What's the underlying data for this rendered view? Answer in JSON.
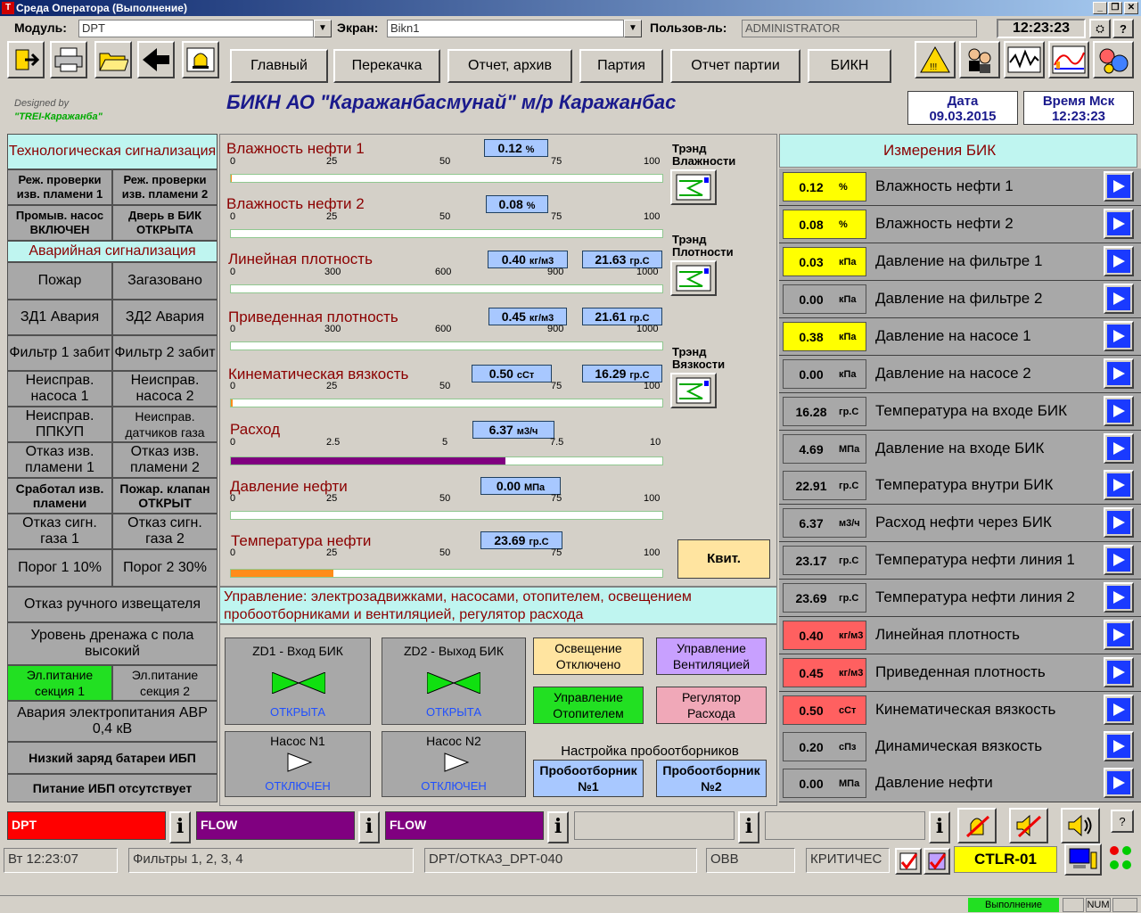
{
  "window": {
    "title": "Среда Оператора (Выполнение)",
    "app_icon": "T"
  },
  "toolbar": {
    "module_label": "Модуль:",
    "module_value": "DPT",
    "screen_label": "Экран:",
    "screen_value": "Bikn1",
    "user_label": "Пользов-ль:",
    "user_value": "ADMINISTRATOR",
    "clock": "12:23:23"
  },
  "nav": {
    "main": "Главный",
    "pump": "Перекачка",
    "report": "Отчет, архив",
    "batch": "Партия",
    "batch_report": "Отчет партии",
    "bikn": "БИКН"
  },
  "header": {
    "designed_by": "Designed by",
    "company": "\"TREI-Каражанба\"",
    "title": "БИКН АО \"Каражанбасмунай\" м/р Каражанбас",
    "date_label": "Дата",
    "date_value": "09.03.2015",
    "time_label": "Время Мск",
    "time_value": "12:23:23"
  },
  "left": {
    "tech_alarm": "Технологическая сигнализация",
    "flame_check1": "Реж. проверки изв. пламени 1",
    "flame_check2": "Реж. проверки изв. пламени 2",
    "flush_pump": "Промыв. насос ВКЛЮЧЕН",
    "door": "Дверь в БИК ОТКРЫТА",
    "emergency": "Аварийная сигнализация",
    "fire": "Пожар",
    "gas": "Загазовано",
    "zd1": "ЗД1 Авария",
    "zd2": "ЗД2 Авария",
    "filter1": "Фильтр 1 забит",
    "filter2": "Фильтр 2 забит",
    "pump1": "Неисправ. насоса 1",
    "pump2": "Неисправ. насоса 2",
    "ppkup": "Неисправ. ППКУП",
    "gas_sensors": "Неисправ. датчиков газа",
    "flame_fail1": "Отказ изв. пламени 1",
    "flame_fail2": "Отказ изв. пламени 2",
    "flame_trig": "Сработал изв. пламени",
    "fire_valve": "Пожар. клапан ОТКРЫТ",
    "gas_sig1": "Отказ сигн. газа 1",
    "gas_sig2": "Отказ сигн. газа 2",
    "thr1": "Порог 1 10%",
    "thr2": "Порог 2 30%",
    "manual": "Отказ ручного извещателя",
    "drain": "Уровень дренажа с пола высокий",
    "power1": "Эл.питание секция 1",
    "power2": "Эл.питание секция 2",
    "avr": "Авария электропитания АВР 0,4 кВ",
    "battery": "Низкий заряд батареи ИБП",
    "ups": "Питание ИБП отсутствует"
  },
  "middle": {
    "moist1": {
      "label": "Влажность нефти 1",
      "value": "0.12",
      "unit": "%",
      "fill": 0.0012
    },
    "moist2": {
      "label": "Влажность нефти 2",
      "value": "0.08",
      "unit": "%",
      "fill": 0.0008
    },
    "lin_dens": {
      "label": "Линейная плотность",
      "value": "0.40",
      "unit": "кг/м3",
      "temp": "21.63",
      "temp_unit": "гр.С",
      "fill": 0.0004
    },
    "red_dens": {
      "label": "Приведенная плотность",
      "value": "0.45",
      "unit": "кг/м3",
      "temp": "21.61",
      "temp_unit": "гр.С",
      "fill": 0.00045
    },
    "visc": {
      "label": "Кинематическая вязкость",
      "value": "0.50",
      "unit": "сСт",
      "temp": "16.29",
      "temp_unit": "гр.С",
      "fill": 0.005
    },
    "flow": {
      "label": "Расход",
      "value": "6.37",
      "unit": "м3/ч",
      "fill": 0.637
    },
    "pressure": {
      "label": "Давление нефти",
      "value": "0.00",
      "unit": "МПа",
      "fill": 0
    },
    "temp": {
      "label": "Температура нефти",
      "value": "23.69",
      "unit": "гр.С",
      "fill": 0.2369
    },
    "scale100": [
      "0",
      "25",
      "50",
      "75",
      "100"
    ],
    "scale1000": [
      "0",
      "300",
      "600",
      "900",
      "1000"
    ],
    "scale10": [
      "0",
      "2.5",
      "5",
      "7.5",
      "10"
    ],
    "trend_moist": "Трэнд Влажности",
    "trend_dens": "Трэнд Плотности",
    "trend_visc": "Трэнд Вязкости",
    "ack": "Квит.",
    "control_title": "Управление: электрозадвижками, насосами, отопителем, освещением пробоотборниками и вентиляцией, регулятор расхода",
    "zd1": {
      "title": "ZD1 - Вход БИК",
      "state": "ОТКРЫТА"
    },
    "zd2": {
      "title": "ZD2 - Выход БИК",
      "state": "ОТКРЫТА"
    },
    "pump1": {
      "title": "Насос N1",
      "state": "ОТКЛЮЧЕН"
    },
    "pump2": {
      "title": "Насос N2",
      "state": "ОТКЛЮЧЕН"
    },
    "lighting": "Освещение Отключено",
    "ventilation": "Управление Вентиляцией",
    "heater": "Управление Отопителем",
    "regulator": "Регулятор Расхода",
    "samplers_title": "Настройка пробоотборников",
    "sampler1": "Пробоотборник №1",
    "sampler2": "Пробоотборник №2"
  },
  "right": {
    "title": "Измерения БИК",
    "rows": [
      {
        "value": "0.12",
        "unit": "%",
        "name": "Влажность нефти 1",
        "color": "#ffff00"
      },
      {
        "value": "0.08",
        "unit": "%",
        "name": "Влажность нефти 2",
        "color": "#ffff00"
      },
      {
        "value": "0.03",
        "unit": "кПа",
        "name": "Давление на фильтре 1",
        "color": "#ffff00"
      },
      {
        "value": "0.00",
        "unit": "кПа",
        "name": "Давление на фильтре 2",
        "color": "#a8a8a8"
      },
      {
        "value": "0.38",
        "unit": "кПа",
        "name": "Давление на насосе 1",
        "color": "#ffff00"
      },
      {
        "value": "0.00",
        "unit": "кПа",
        "name": "Давление на насосе 2",
        "color": "#a8a8a8"
      },
      {
        "value": "16.28",
        "unit": "гр.С",
        "name": "Температура на входе БИК",
        "color": "#a8a8a8"
      },
      {
        "value": "4.69",
        "unit": "МПа",
        "name": "Давление на входе БИК",
        "color": "#a8a8a8"
      },
      {
        "value": "22.91",
        "unit": "гр.С",
        "name": "Температура внутри БИК",
        "color": "#a8a8a8"
      },
      {
        "value": "6.37",
        "unit": "м3/ч",
        "name": "Расход нефти через БИК",
        "color": "#a8a8a8"
      },
      {
        "value": "23.17",
        "unit": "гр.С",
        "name": "Температура нефти линия 1",
        "color": "#a8a8a8"
      },
      {
        "value": "23.69",
        "unit": "гр.С",
        "name": "Температура нефти линия 2",
        "color": "#a8a8a8"
      },
      {
        "value": "0.40",
        "unit": "кг/м3",
        "name": "Линейная плотность",
        "color": "#ff6060"
      },
      {
        "value": "0.45",
        "unit": "кг/м3",
        "name": "Приведенная плотность",
        "color": "#ff6060"
      },
      {
        "value": "0.50",
        "unit": "сСт",
        "name": "Кинематическая вязкость",
        "color": "#ff6060"
      },
      {
        "value": "0.20",
        "unit": "сПз",
        "name": "Динамическая вязкость",
        "color": "#a8a8a8"
      },
      {
        "value": "0.00",
        "unit": "МПа",
        "name": "Давление нефти",
        "color": "#a8a8a8"
      }
    ]
  },
  "alarms": {
    "a1": "DPT",
    "a2": "FLOW",
    "a3": "FLOW",
    "a4": "",
    "a5": "",
    "info": "i",
    "help": "?"
  },
  "status": {
    "time": "Вт 12:23:07",
    "filters": "Фильтры 1, 2, 3, 4",
    "code": "DPT/ОТКАЗ_DPT-040",
    "ovv": "ОВВ",
    "crit": "КРИТИЧЕС",
    "ctlr": "CTLR-01",
    "run": "Выполнение",
    "num": "NUM"
  },
  "colors": {
    "accent_cyan": "#bff5f0",
    "alarm_red": "#ff0000",
    "flow_purple": "#800080",
    "temp_orange": "#ff8c1a",
    "ctlr_yellow": "#ffff00"
  }
}
